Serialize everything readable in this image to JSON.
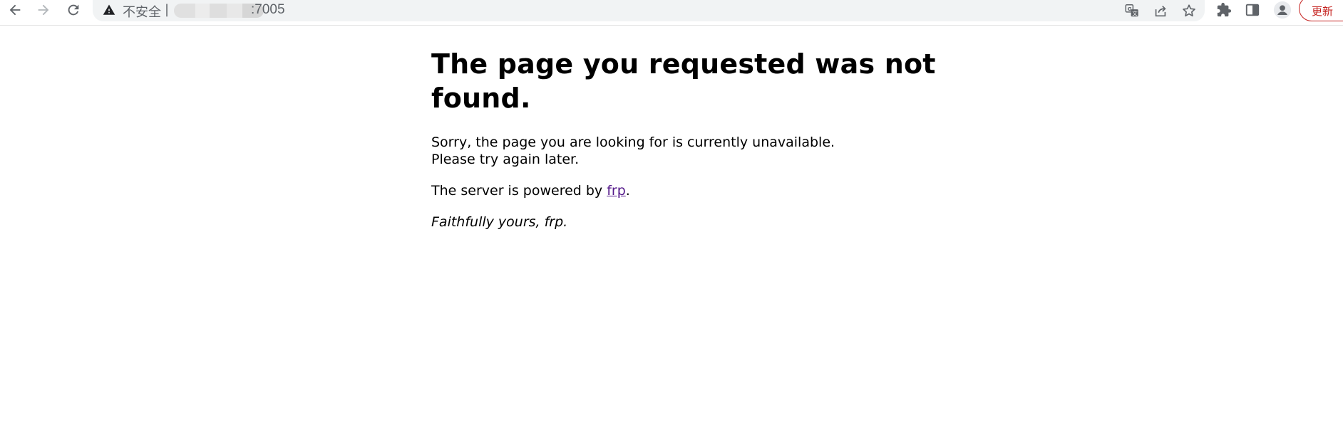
{
  "browser": {
    "address_bar": {
      "security_label": "不安全",
      "separator": "|",
      "url_suffix": ":7005"
    },
    "update_label": "更新",
    "colors": {
      "update": "#c5221f",
      "omnibox": "#f1f3f4",
      "icon": "#5f6368"
    },
    "icons": [
      "back-icon",
      "forward-icon",
      "reload-icon",
      "warning-icon",
      "translate-icon",
      "share-icon",
      "star-icon",
      "extensions-icon",
      "side-panel-icon",
      "profile-icon"
    ]
  },
  "page": {
    "heading": "The page you requested was not found.",
    "paragraph1_line1": "Sorry, the page you are looking for is currently unavailable.",
    "paragraph1_line2": "Please try again later.",
    "powered_prefix": "The server is powered by ",
    "powered_link": "frp",
    "powered_suffix": ".",
    "signature": "Faithfully yours, frp."
  }
}
